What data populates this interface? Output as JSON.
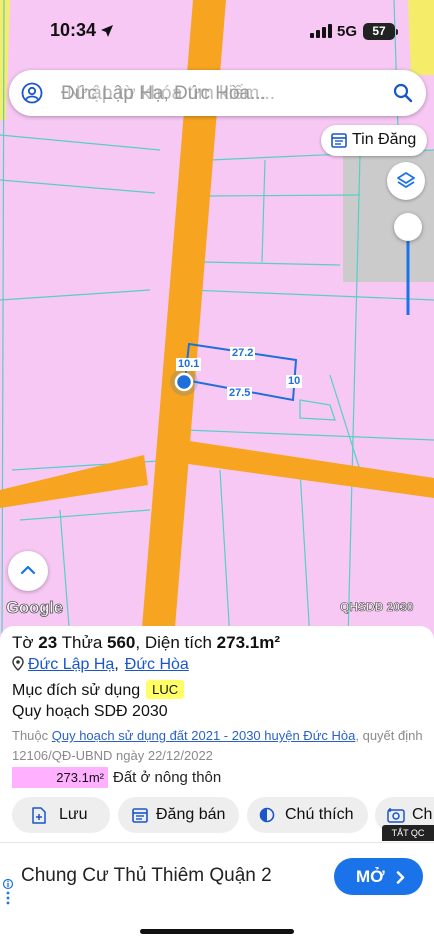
{
  "status": {
    "time": "10:34",
    "network": "5G",
    "battery": "57"
  },
  "search": {
    "placeholder": "Đức Lập Hạ, Đức Hòa...",
    "ghost_text": "Nhập từ khóa tìm kiếm..."
  },
  "map": {
    "tin_dang_label": "Tin Đăng",
    "attribution": "Google",
    "watermark": "QHSDĐ 2030",
    "measurements": {
      "top": "27.2",
      "left": "10.1",
      "right": "10",
      "bottom": "27.5"
    },
    "colors": {
      "land": "#f7c8f3",
      "road": "#f7a520",
      "parcel_outline": "#56cfc8",
      "selection": "#1e6fd9"
    }
  },
  "parcel": {
    "title_prefix": "Tờ ",
    "sheet_no": "23",
    "plot_prefix": " Thửa ",
    "plot_no": "560",
    "area_prefix": ", Diện tích ",
    "area": "273.1m²",
    "commune": "Đức Lập Hạ",
    "district": "Đức Hòa",
    "purpose_label": "Mục đích sử dụng",
    "purpose_code": "LUC",
    "plan_label": "Quy hoạch SDĐ 2030",
    "plan_source_prefix": "Thuộc ",
    "plan_source_link": "Quy hoạch sử dụng đất 2021 - 2030 huyện Đức Hòa",
    "plan_source_suffix": ", quyết định 12106/QĐ-UBND ngày 22/12/2022",
    "zone_area": "273.1m²",
    "zone_label": "Đất ở nông thôn"
  },
  "actions": {
    "save": "Lưu",
    "post": "Đăng bán",
    "note": "Chú thích",
    "photo": "Ch"
  },
  "ad": {
    "tag": "TẮT QC",
    "title": "Chung Cư Thủ Thiêm Quận 2",
    "button": "MỞ"
  }
}
